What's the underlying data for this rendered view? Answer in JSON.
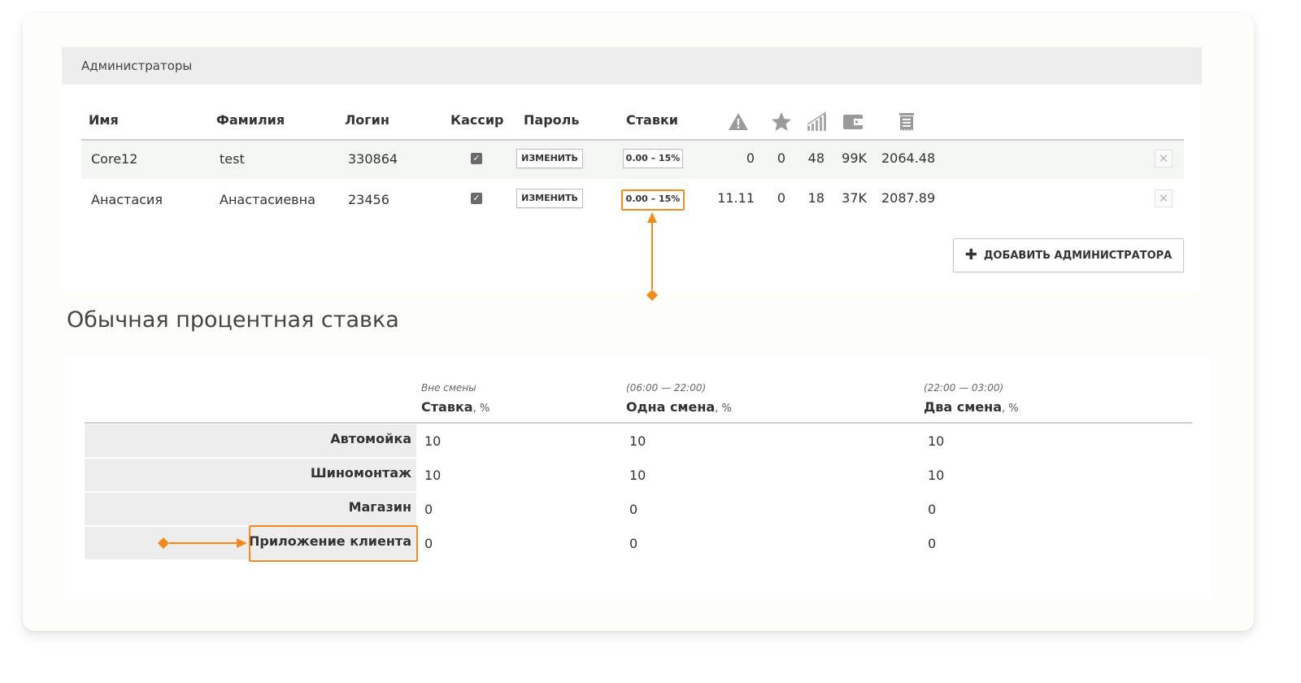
{
  "admins": {
    "panel_title": "Администраторы",
    "columns": [
      "Имя",
      "Фамилия",
      "Логин",
      "Кассир",
      "Пароль",
      "Ставки"
    ],
    "icon_columns": [
      "warning-icon",
      "star-icon",
      "signal-bars-icon",
      "wallet-icon",
      "receipt-icon"
    ],
    "rows": [
      {
        "first_name": "Core12",
        "last_name": "test",
        "login": "330864",
        "cashier": true,
        "password_button": "ИЗМЕНИТЬ",
        "rate": "0.00 – 15%",
        "m1": "0",
        "m2": "0",
        "m3": "48",
        "m4": "99K",
        "m5": "2064.48"
      },
      {
        "first_name": "Анастасия",
        "last_name": "Анастасиевна",
        "login": "23456",
        "cashier": true,
        "password_button": "ИЗМЕНИТЬ",
        "rate": "0.00 – 15%",
        "m1": "11.11",
        "m2": "0",
        "m3": "18",
        "m4": "37K",
        "m5": "2087.89"
      }
    ],
    "add_button": "ДОБАВИТЬ АДМИНИСТРАТОРА"
  },
  "rates": {
    "title": "Обычная процентная ставка",
    "columns": [
      {
        "sub": "Вне смены",
        "title": "Ставка",
        "unit": ", %"
      },
      {
        "sub": "(06:00 — 22:00)",
        "title": "Одна смена",
        "unit": ", %"
      },
      {
        "sub": "(22:00 — 03:00)",
        "title": "Два смена",
        "unit": ", %"
      }
    ],
    "rows": [
      {
        "label": "Автомойка",
        "values": [
          "10",
          "10",
          "10"
        ]
      },
      {
        "label": "Шиномонтаж",
        "values": [
          "10",
          "10",
          "10"
        ]
      },
      {
        "label": "Магазин",
        "values": [
          "0",
          "0",
          "0"
        ]
      },
      {
        "label": "Приложение клиента",
        "values": [
          "0",
          "0",
          "0"
        ]
      }
    ]
  },
  "colors": {
    "accent": "#f28a1d",
    "header_bg": "#ededed",
    "row_highlight": "#f3f6f3"
  }
}
